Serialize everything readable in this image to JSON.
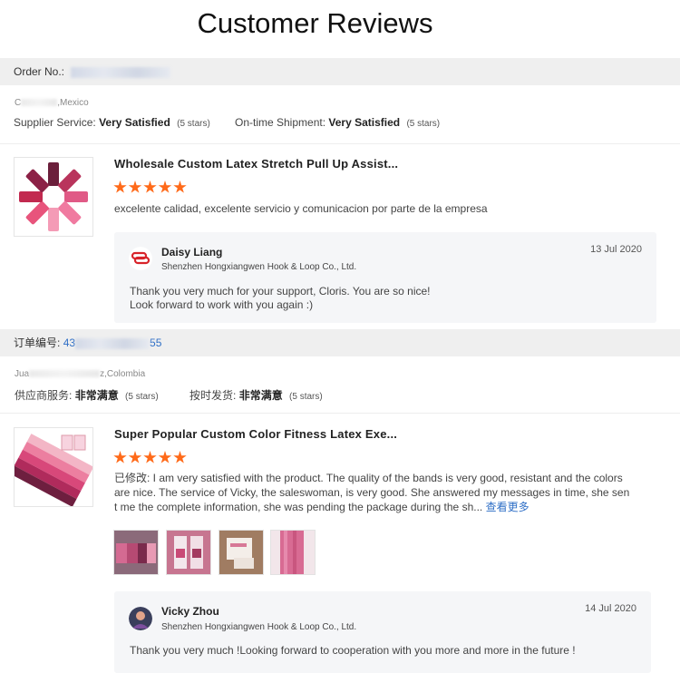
{
  "page_title": "Customer Reviews",
  "reviews": [
    {
      "order_label": "Order No.:",
      "order_number_visible": "",
      "location_prefix": "C",
      "location_suffix": ",Mexico",
      "supplier_label": "Supplier Service:",
      "supplier_value": "Very Satisfied",
      "supplier_stars": "(5 stars)",
      "shipment_label": "On-time Shipment:",
      "shipment_value": "Very Satisfied",
      "shipment_stars": "(5 stars)",
      "product_title": "Wholesale Custom Latex Stretch Pull Up Assist...",
      "rating": 5,
      "review_text": "excelente calidad, excelente servicio y comunicacion por parte de la empresa",
      "reply": {
        "name": "Daisy Liang",
        "company": "Shenzhen Hongxiangwen Hook & Loop Co., Ltd.",
        "date": "13 Jul 2020",
        "line1": "Thank you very much for your support, Cloris.  You are so nice!",
        "line2": "Look forward to work with you again :)"
      }
    },
    {
      "order_label": "订单编号:",
      "order_number_start": "43",
      "order_number_end": "55",
      "location_prefix": "Jua",
      "location_suffix": "z,Colombia",
      "supplier_label": "供应商服务:",
      "supplier_value": "非常满意",
      "supplier_stars": "(5 stars)",
      "shipment_label": "按时发货:",
      "shipment_value": "非常满意",
      "shipment_stars": "(5 stars)",
      "product_title": "Super Popular Custom Color Fitness Latex Exe...",
      "rating": 5,
      "review_line1": "已修改: I am very satisfied with the product.  The quality of the bands is very good, resistant and the colors",
      "review_line2": "are nice.  The service of Vicky, the saleswoman, is very good.  She answered my messages in time, she sen",
      "review_line3": "t me the complete information, she was pending the package during the sh...",
      "more_label": "查看更多",
      "reply": {
        "name": "Vicky Zhou",
        "company": "Shenzhen Hongxiangwen Hook & Loop Co., Ltd.",
        "date": "14 Jul 2020",
        "line1": "Thank you very much !Looking forward to cooperation with you more and more in the future !"
      }
    }
  ],
  "colors": {
    "star": "#ff6a19",
    "link": "#2f6fc6",
    "bar": "#efefef",
    "reply_bg": "#f5f6f8"
  }
}
